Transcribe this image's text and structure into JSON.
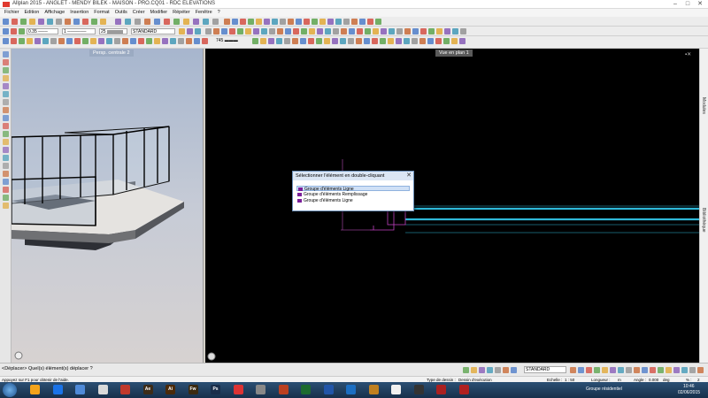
{
  "titlebar": {
    "title": "Allplan 2015 - ANGLET - MENDY BILEK - MAISON - PRO.CQ01 - RDC ELEVATIONS"
  },
  "menu": [
    "Fichier",
    "Edition",
    "Affichage",
    "Insertion",
    "Format",
    "Outils",
    "Créer",
    "Modifier",
    "Répéter",
    "Fenêtre",
    "?"
  ],
  "toolbar2": {
    "pen_value": "0.35",
    "line_value": "1",
    "color_value": "25",
    "layer_value": "STANDARD"
  },
  "toolbar3": {
    "scale_value": "745"
  },
  "viewports": {
    "left_label": "Persp. centrale 2",
    "right_label": "Vue en plan 1"
  },
  "right_panel": {
    "tab1": "Modules",
    "tab2": "Bibliothèque"
  },
  "dialog": {
    "title": "Sélectionner l'élément en double-cliquant",
    "items": [
      {
        "label": "Groupe d'éléments Ligne"
      },
      {
        "label": "Groupe d'éléments Remplissage"
      },
      {
        "label": "Groupe d'éléments Ligne"
      }
    ],
    "swatch_color": "#7a1f9a"
  },
  "bottombar": {
    "prompt": "<Déplacer> Quel(s) élément(s) déplacer ?",
    "layer_select": "STANDARD"
  },
  "statusbar": {
    "help": "Appuyez sur F1 pour obtenir de l'aide.",
    "type_label": "Type de dessin :",
    "type_value": "Dessin d'exécution",
    "echelle_label": "Echelle :",
    "echelle_value": "1 : 50",
    "longueur_label": "Longueur :",
    "longueur_value": "m",
    "angle_label": "Angle :",
    "angle_value": "0.000",
    "deg_label": "deg",
    "pct_label": "% :",
    "pct_value": "2"
  },
  "taskbar": {
    "group_label": "Groupe résidentiel",
    "time": "10:46",
    "date": "02/06/2015"
  },
  "colors": {
    "plan_cyan": "#2fb8d8",
    "plan_magenta": "#c040c0",
    "accent": "#2b4f73"
  }
}
